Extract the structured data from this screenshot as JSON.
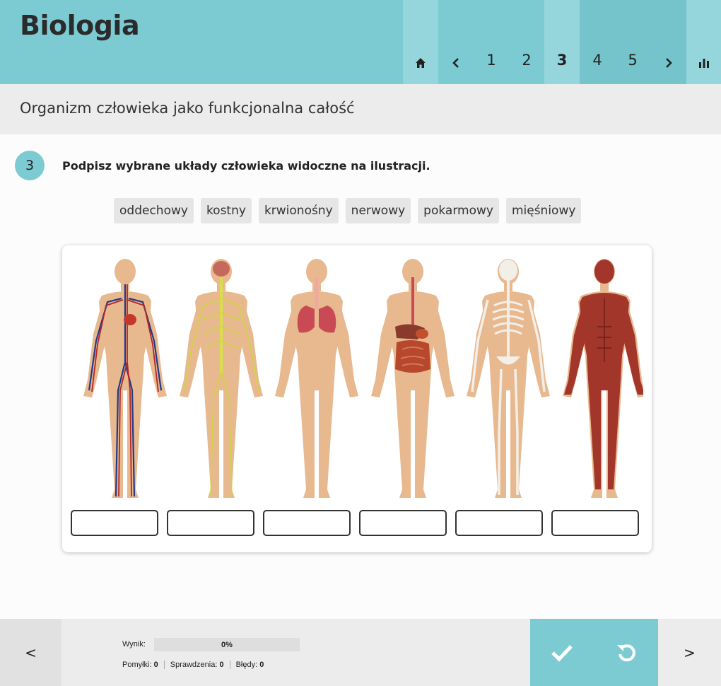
{
  "header": {
    "title": "Biologia",
    "nav": {
      "home_icon": "home-icon",
      "prev_icon": "chevron-left-icon",
      "pages": [
        "1",
        "2",
        "3",
        "4",
        "5"
      ],
      "current_page": "3",
      "next_icon": "chevron-right-icon",
      "stats_icon": "bar-chart-icon"
    }
  },
  "subtitle": "Organizm człowieka jako funkcjonalna całość",
  "task": {
    "number": "3",
    "instruction": "Podpisz wybrane układy człowieka widoczne na ilustracji.",
    "chips": [
      "oddechowy",
      "kostny",
      "krwionośny",
      "nerwowy",
      "pokarmowy",
      "mięśniowy"
    ],
    "figures": [
      {
        "depicts": "circulatory-system-figure",
        "answer": ""
      },
      {
        "depicts": "nervous-system-figure",
        "answer": ""
      },
      {
        "depicts": "respiratory-system-figure",
        "answer": ""
      },
      {
        "depicts": "digestive-system-figure",
        "answer": ""
      },
      {
        "depicts": "skeletal-system-figure",
        "answer": ""
      },
      {
        "depicts": "muscular-system-figure",
        "answer": ""
      }
    ]
  },
  "footer": {
    "prev_label": "<",
    "next_label": ">",
    "score_label": "Wynik:",
    "score_value": "0%",
    "score_fraction": 0,
    "stats": {
      "mistakes_label": "Pomyłki:",
      "mistakes": "0",
      "checks_label": "Sprawdzenia:",
      "checks": "0",
      "errors_label": "Błędy:",
      "errors": "0"
    },
    "check_icon": "checkmark-icon",
    "reset_icon": "reset-icon"
  },
  "colors": {
    "accent": "#7ccbd3",
    "accent_light": "#95d6dc",
    "band": "#ececec",
    "skin": "#e8b88f"
  }
}
